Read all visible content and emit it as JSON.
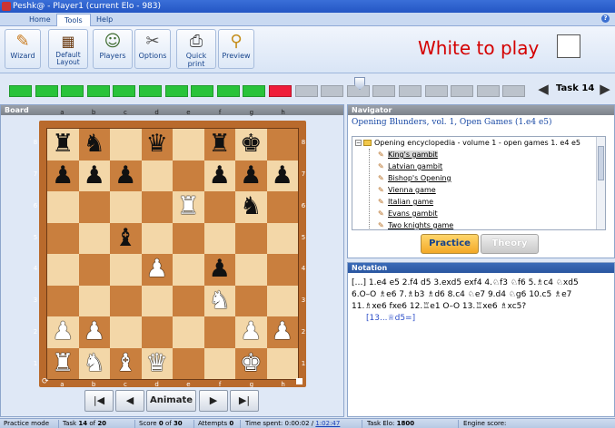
{
  "window": {
    "title": "Peshk@ - Player1 (current Elo - 983)"
  },
  "ribbon": {
    "tabs": [
      "Home",
      "Tools",
      "Help"
    ],
    "active_tab": "Tools",
    "buttons": [
      {
        "label": "Wizard",
        "icon": "wand-icon"
      },
      {
        "label": "Default Layout",
        "icon": "board-layout-icon"
      },
      {
        "label": "Players",
        "icon": "players-icon"
      },
      {
        "label": "Options",
        "icon": "tools-icon"
      },
      {
        "label": "Quick print",
        "icon": "printer-icon"
      },
      {
        "label": "Preview",
        "icon": "magnifier-icon"
      }
    ],
    "turn_text": "White to play"
  },
  "progress": {
    "done": 10,
    "current": 1,
    "remaining": 9,
    "task_label": "Task 14",
    "colors": {
      "done": "#29c33a",
      "current": "#ef1d3a",
      "todo": "#bcc3cc"
    }
  },
  "board_panel": {
    "title": "Board",
    "files": [
      "a",
      "b",
      "c",
      "d",
      "e",
      "f",
      "g",
      "h"
    ],
    "ranks": [
      "8",
      "7",
      "6",
      "5",
      "4",
      "3",
      "2",
      "1"
    ],
    "position": [
      [
        "r",
        "n",
        "",
        "q",
        "",
        "r",
        "k",
        ""
      ],
      [
        "p",
        "p",
        "p",
        "",
        "",
        "p",
        "p",
        "p"
      ],
      [
        "",
        "",
        "",
        "",
        "R",
        "",
        "n",
        ""
      ],
      [
        "",
        "",
        "b",
        "",
        "",
        "",
        "",
        ""
      ],
      [
        "",
        "",
        "",
        "P",
        "",
        "p",
        "",
        ""
      ],
      [
        "",
        "",
        "",
        "",
        "",
        "N",
        "",
        ""
      ],
      [
        "P",
        "P",
        "",
        "",
        "",
        "",
        "P",
        "P"
      ],
      [
        "R",
        "N",
        "B",
        "Q",
        "",
        "",
        "K",
        ""
      ]
    ],
    "controls": {
      "first": "|◀",
      "prev": "◀",
      "animate": "Animate",
      "next": "▶",
      "last": "▶|"
    }
  },
  "navigator": {
    "title": "Navigator",
    "book": "Opening Blunders, vol. 1, Open Games (1.e4 e5)",
    "root": "Opening encyclopedia - volume 1 - open games 1. e4 e5",
    "items": [
      "King's gambit",
      "Latvian gambit",
      "Bishop's Opening",
      "Vienna game",
      "Italian game",
      "Evans gambit",
      "Two knights game"
    ],
    "selected": "King's gambit",
    "practice_label": "Practice",
    "theory_label": "Theory"
  },
  "notation": {
    "title": "Notation",
    "line1": "[…] 1.e4 e5 2.f4 d5 3.exd5 exf4 4.♘f3 ♘f6 5.♗c4 ♘xd5",
    "line2": "6.O–O ♗e6 7.♗b3 ♗d6 8.c4 ♘e7 9.d4 ♘g6 10.c5 ♗e7",
    "line3": "11.♗xe6 fxe6 12.♖e1 O–O 13.♖xe6 ♗xc5?",
    "variation": "[13...♕d5=]"
  },
  "status": {
    "mode": "Practice mode",
    "task_prefix": "Task",
    "task_num": "14",
    "task_of": "of",
    "task_total": "20",
    "score_prefix": "Score",
    "score": "0",
    "score_of": "of",
    "score_total": "30",
    "attempts_label": "Attempts",
    "attempts": "0",
    "time_label": "Time spent:",
    "time_spent": "0:00:02",
    "time_sep": "/",
    "time_limit": "1:02:47",
    "elo_label": "Task Elo:",
    "elo": "1800",
    "engine_label": "Engine score:"
  }
}
